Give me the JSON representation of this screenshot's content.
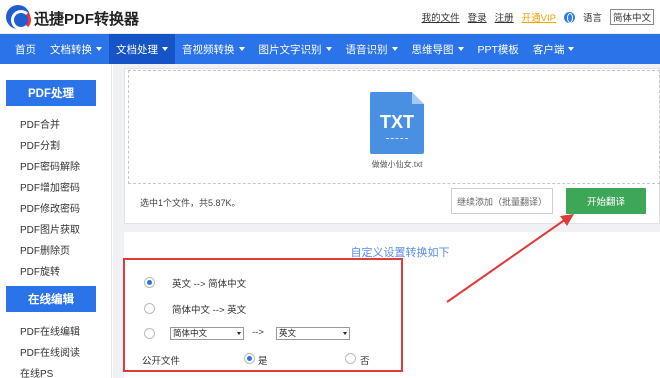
{
  "header": {
    "brand": "迅捷PDF转换器",
    "links": [
      "我的文件",
      "登录",
      "注册",
      "开通VIP"
    ],
    "lang_label": "语言",
    "lang_value": "简体中文"
  },
  "nav": {
    "items": [
      {
        "label": "首页",
        "caret": false,
        "active": false
      },
      {
        "label": "文档转换",
        "caret": true,
        "active": false
      },
      {
        "label": "文档处理",
        "caret": true,
        "active": true
      },
      {
        "label": "音视频转换",
        "caret": true,
        "active": false
      },
      {
        "label": "图片文字识别",
        "caret": true,
        "active": false
      },
      {
        "label": "语音识别",
        "caret": true,
        "active": false
      },
      {
        "label": "思维导图",
        "caret": true,
        "active": false
      },
      {
        "label": "PPT模板",
        "caret": false,
        "active": false
      },
      {
        "label": "客户端",
        "caret": true,
        "active": false
      }
    ]
  },
  "sidebar": {
    "section1": "PDF处理",
    "items1": [
      "PDF合并",
      "PDF分割",
      "PDF密码解除",
      "PDF增加密码",
      "PDF修改密码",
      "PDF图片获取",
      "PDF删除页",
      "PDF旋转"
    ],
    "section2": "在线编辑",
    "items2": [
      "PDF在线编辑",
      "PDF在线阅读",
      "在线PS"
    ]
  },
  "upload": {
    "file_ext": "TXT",
    "file_name": "做做小仙女.txt",
    "status": "选中1个文件，共5.87K。",
    "add_button": "继续添加（批量翻译）",
    "start_button": "开始翻译"
  },
  "settings": {
    "title": "自定义设置转换如下",
    "option1": "英文 --> 简体中文",
    "option2": "简体中文 --> 英文",
    "custom_from": "简体中文",
    "custom_arrow": "-->",
    "custom_to": "英文",
    "public_label": "公开文件",
    "public_yes": "是",
    "public_no": "否",
    "selected_option": 1,
    "public_selected": "yes"
  },
  "colors": {
    "nav_bg": "#2a73e8",
    "start_button": "#3ea657",
    "highlight": "#e03a3a"
  }
}
